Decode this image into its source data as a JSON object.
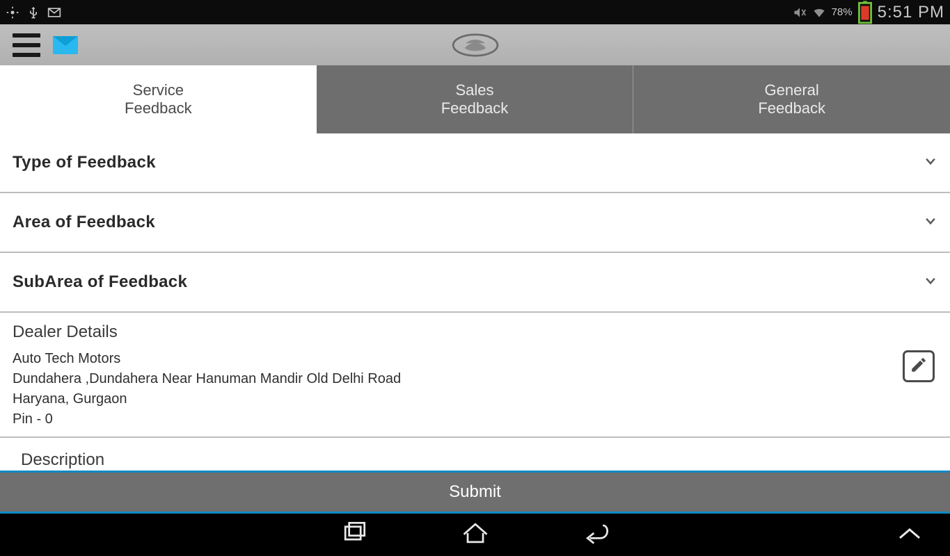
{
  "status": {
    "left_icons": [
      "gps-icon",
      "usb-icon",
      "mail-icon"
    ],
    "battery_pct": "78%",
    "time": "5:51 PM"
  },
  "tabs": {
    "service": "Service\nFeedback",
    "sales": "Sales\nFeedback",
    "general": "General\nFeedback"
  },
  "dropdowns": {
    "type": "Type of Feedback",
    "area": "Area of Feedback",
    "subarea": "SubArea of Feedback"
  },
  "dealer": {
    "title": "Dealer Details",
    "name": "Auto Tech Motors",
    "address": "Dundahera ,Dundahera  Near Hanuman Mandir  Old Delhi Road",
    "city_state": "Haryana, Gurgaon",
    "pin": "Pin - 0"
  },
  "description": {
    "label": "Description"
  },
  "submit_label": "Submit"
}
